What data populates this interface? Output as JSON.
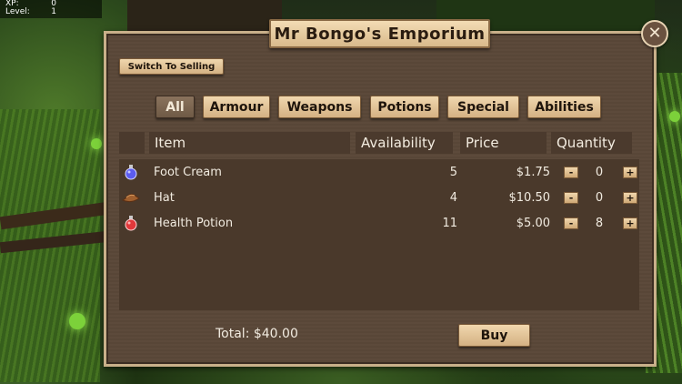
{
  "hud": {
    "xp_label": "XP:",
    "xp_value": "0",
    "level_label": "Level:",
    "level_value": "1"
  },
  "shop": {
    "title": "Mr Bongo's Emporium",
    "switch_label": "Switch To Selling",
    "close_symbol": "✕",
    "categories": [
      {
        "label": "All",
        "active": true
      },
      {
        "label": "Armour"
      },
      {
        "label": "Weapons"
      },
      {
        "label": "Potions"
      },
      {
        "label": "Special"
      },
      {
        "label": "Abilities"
      }
    ],
    "columns": {
      "item": "Item",
      "availability": "Availability",
      "price": "Price",
      "quantity": "Quantity"
    },
    "items": [
      {
        "icon": "blue-potion-icon",
        "name": "Foot Cream",
        "availability": "5",
        "price": "$1.75",
        "quantity": "0"
      },
      {
        "icon": "hat-icon",
        "name": "Hat",
        "availability": "4",
        "price": "$10.50",
        "quantity": "0"
      },
      {
        "icon": "red-potion-icon",
        "name": "Health Potion",
        "availability": "11",
        "price": "$5.00",
        "quantity": "8"
      }
    ],
    "minus_symbol": "-",
    "plus_symbol": "+",
    "total": "Total: $40.00",
    "buy_label": "Buy"
  },
  "colors": {
    "panel": "#5a4738",
    "button": "#e4c597",
    "header_cell": "#4b3a2d",
    "text_light": "#f1ebe0"
  }
}
